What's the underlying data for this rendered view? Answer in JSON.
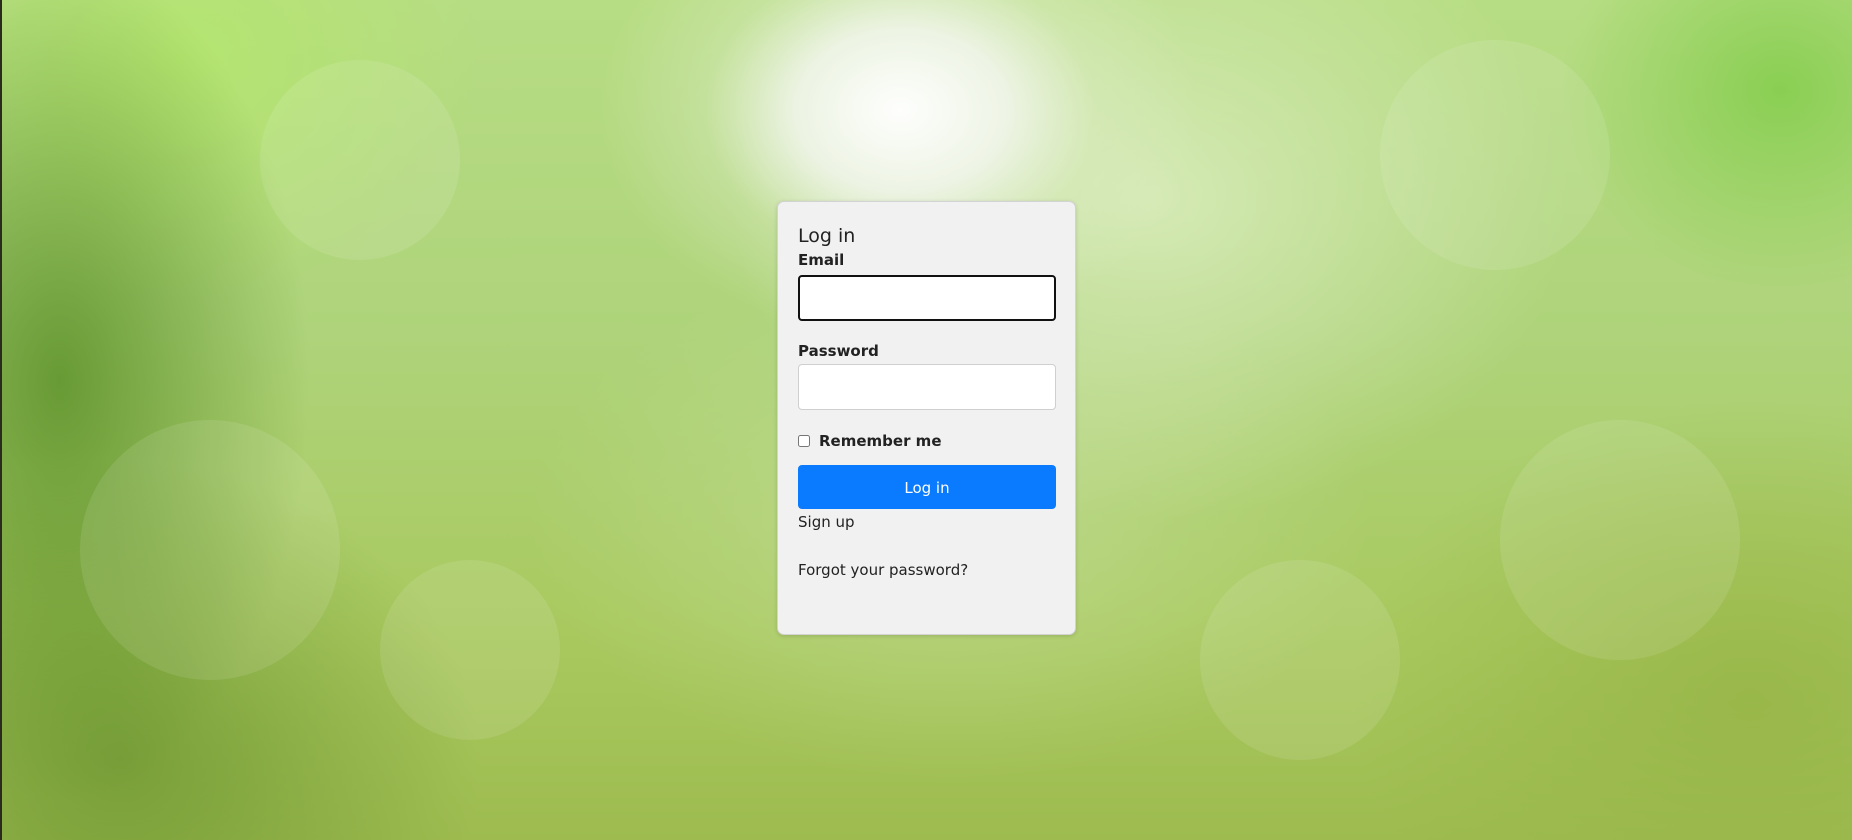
{
  "page": {
    "background_colors": {
      "top_glow": "#ffffff",
      "green_light": "#b7dd84",
      "green_dark": "#5a8a2a"
    }
  },
  "login_card": {
    "title": "Log in",
    "email_label": "Email",
    "email_value": "",
    "password_label": "Password",
    "password_value": "",
    "remember_label": "Remember me",
    "remember_checked": false,
    "submit_label": "Log in",
    "signup_link": "Sign up",
    "forgot_link": "Forgot your password?",
    "accent_color": "#0a7bff"
  }
}
